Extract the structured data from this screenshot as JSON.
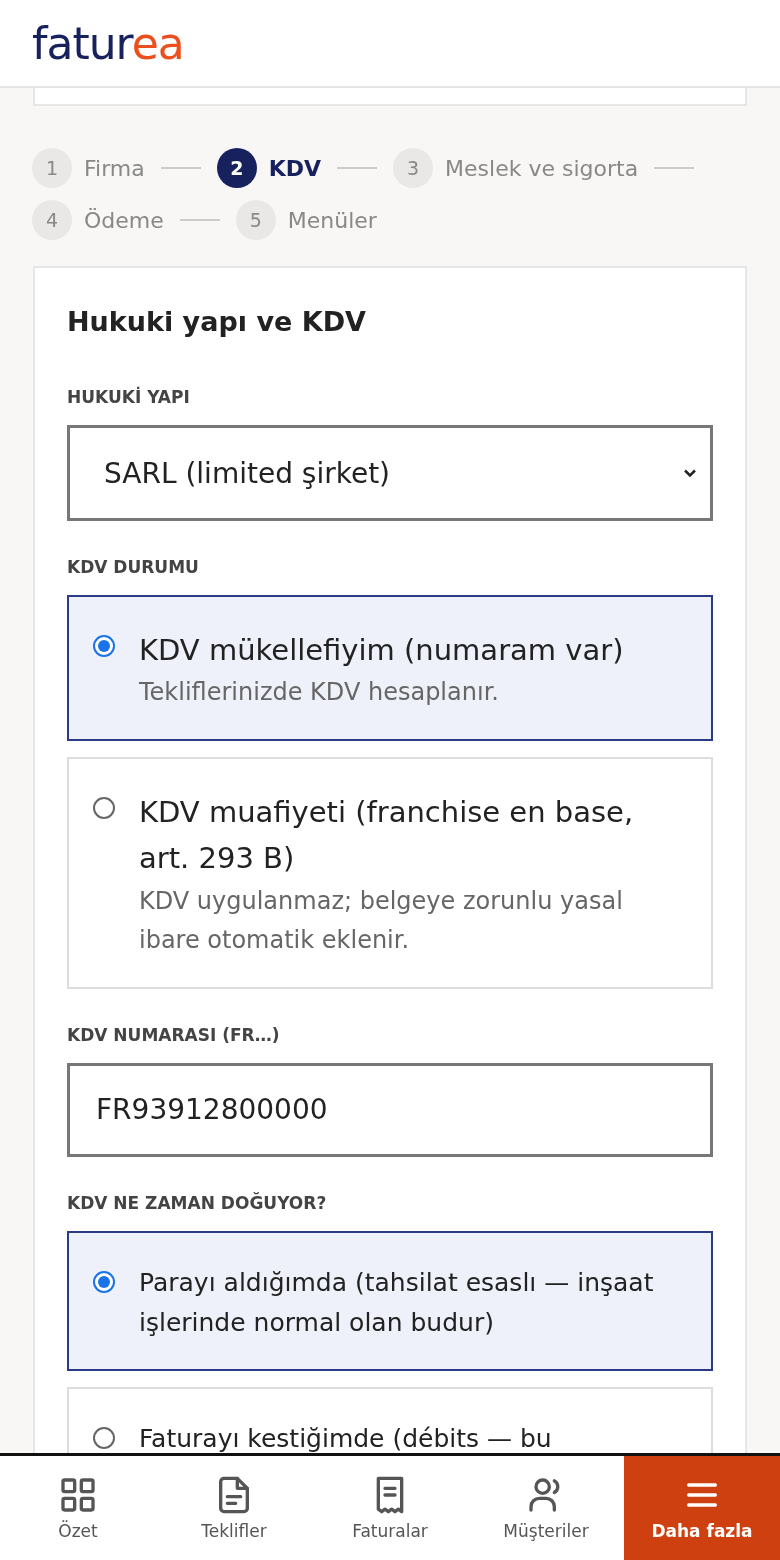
{
  "logo": {
    "part_1": "fatur",
    "part_2": "ea"
  },
  "steps": [
    {
      "number": "1",
      "label": "Firma",
      "selected": false
    },
    {
      "number": "2",
      "label": "KDV",
      "selected": true
    },
    {
      "number": "3",
      "label": "Meslek ve sigorta",
      "selected": false
    },
    {
      "number": "4",
      "label": "Ödeme",
      "selected": false
    },
    {
      "number": "5",
      "label": "Menüler",
      "selected": false
    }
  ],
  "card": {
    "title": "Hukuki yapı ve KDV",
    "sections": [
      {
        "kind": "select",
        "label": "HUKUKİ YAPI",
        "value": "SARL (limited şirket)"
      },
      {
        "kind": "radios",
        "label": "KDV DURUMU",
        "options": [
          {
            "title": "KDV mükellefiyim (numaram var)",
            "description": "Tekliflerinizde KDV hesaplanır.",
            "selected": true,
            "kind": "detailed"
          },
          {
            "title": "KDV muafiyeti (franchise en base, art. 293 B)",
            "description": "KDV uygulanmaz; belgeye zorunlu yasal ibare otomatik eklenir.",
            "selected": false,
            "kind": "detailed"
          }
        ]
      },
      {
        "kind": "input",
        "label": "KDV NUMARASI (FR…)",
        "value": "FR93912800000"
      },
      {
        "kind": "radios",
        "label": "KDV NE ZAMAN DOĞUYOR?",
        "options": [
          {
            "title": "Parayı aldığımda (tahsilat esaslı — inşaat işlerinde normal olan budur)",
            "selected": true,
            "kind": "simple"
          },
          {
            "title": "Faturayı kestiğimde (débits — bu",
            "selected": false,
            "kind": "simple"
          }
        ]
      }
    ]
  },
  "nav": [
    {
      "kind": "grid",
      "label": "Özet",
      "selected": false
    },
    {
      "kind": "document",
      "label": "Teklifler",
      "selected": false
    },
    {
      "kind": "receipt",
      "label": "Faturalar",
      "selected": false
    },
    {
      "kind": "users",
      "label": "Müşteriler",
      "selected": false
    },
    {
      "kind": "menu",
      "label": "Daha fazla",
      "selected": true
    }
  ]
}
